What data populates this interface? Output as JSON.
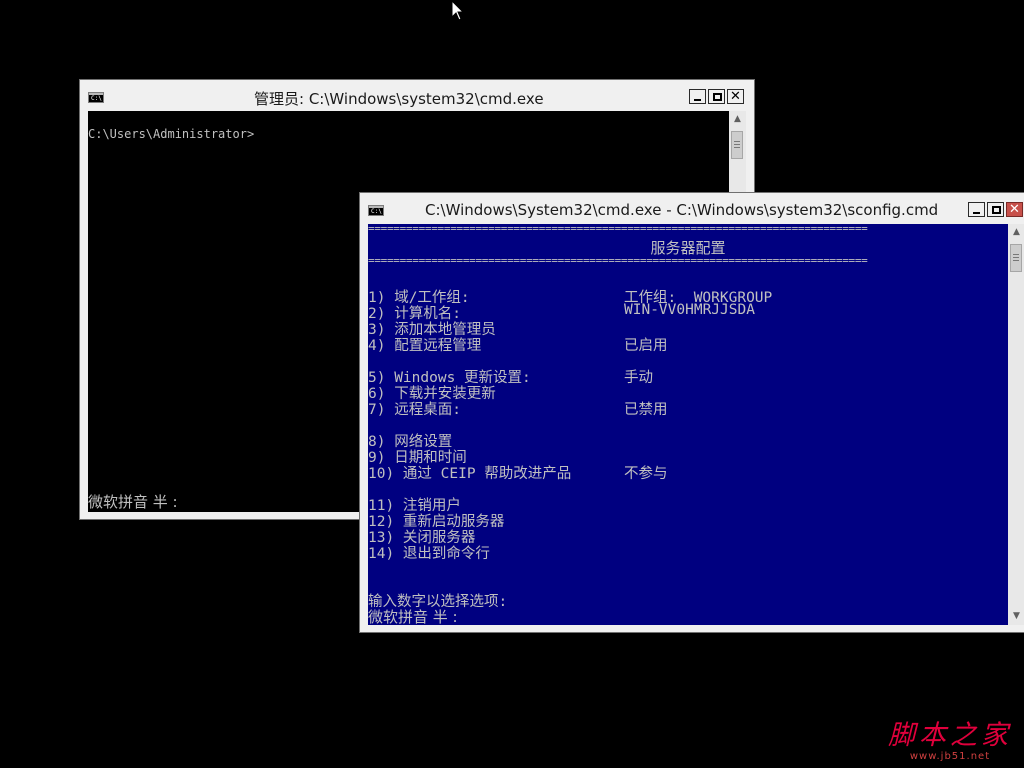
{
  "cmd_window": {
    "title": "管理员: C:\\Windows\\system32\\cmd.exe",
    "icon": "C:\\",
    "prompt": "C:\\Users\\Administrator>",
    "ime_status": "微软拼音 半 :"
  },
  "sconfig_window": {
    "title": "C:\\Windows\\System32\\cmd.exe - C:\\Windows\\system32\\sconfig.cmd",
    "icon": "C:\\",
    "separator": "===============================================================================",
    "heading": "服务器配置",
    "menu": [
      {
        "label": "1) 域/工作组:",
        "value": "工作组:  WORKGROUP"
      },
      {
        "label": "2) 计算机名:",
        "value": "WIN-VV0HMRJJSDA"
      },
      {
        "label": "3) 添加本地管理员",
        "value": ""
      },
      {
        "label": "4) 配置远程管理",
        "value": "已启用"
      },
      {
        "label": "5) Windows 更新设置:",
        "value": "手动"
      },
      {
        "label": "6) 下载并安装更新",
        "value": ""
      },
      {
        "label": "7) 远程桌面:",
        "value": "已禁用"
      },
      {
        "label": "8) 网络设置",
        "value": ""
      },
      {
        "label": "9) 日期和时间",
        "value": ""
      },
      {
        "label": "10) 通过 CEIP 帮助改进产品",
        "value": "不参与"
      },
      {
        "label": "11) 注销用户",
        "value": ""
      },
      {
        "label": "12) 重新启动服务器",
        "value": ""
      },
      {
        "label": "13) 关闭服务器",
        "value": ""
      },
      {
        "label": "14) 退出到命令行",
        "value": ""
      }
    ],
    "input_prompt": "输入数字以选择选项:",
    "ime_status": "微软拼音 半 :"
  },
  "watermark": {
    "main": "脚本之家",
    "sub": "www.jb51.net"
  }
}
